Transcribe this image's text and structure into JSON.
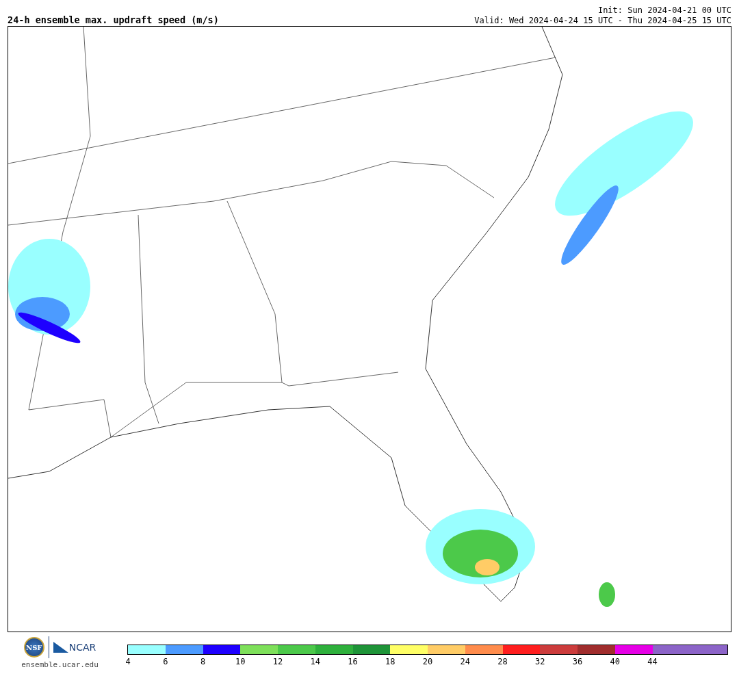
{
  "title": "24-h ensemble max. updraft speed (m/s)",
  "init": "Init: Sun 2024-04-21 00 UTC",
  "valid": "Valid: Wed 2024-04-24 15 UTC - Thu 2024-04-25 15 UTC",
  "logos": {
    "nsf": "NSF",
    "ncar": "NCAR",
    "url": "ensemble.ucar.edu"
  },
  "colorbar": [
    {
      "color": "#99ffff",
      "label": "4"
    },
    {
      "color": "#4c9bff",
      "label": "6"
    },
    {
      "color": "#1e00ff",
      "label": "8"
    },
    {
      "color": "#7ee05a",
      "label": "10"
    },
    {
      "color": "#4cc94a",
      "label": "12"
    },
    {
      "color": "#2eb03c",
      "label": "14"
    },
    {
      "color": "#1e9438",
      "label": "16"
    },
    {
      "color": "#ffff66",
      "label": "18"
    },
    {
      "color": "#ffcc66",
      "label": "20"
    },
    {
      "color": "#ff8c4c",
      "label": "24"
    },
    {
      "color": "#ff1e1e",
      "label": "28"
    },
    {
      "color": "#cc3c3c",
      "label": "32"
    },
    {
      "color": "#a02d2d",
      "label": "36"
    },
    {
      "color": "#e600e6",
      "label": "40"
    },
    {
      "color": "#8c64c8",
      "label": "44"
    },
    {
      "color": "#8c64c8"
    }
  ]
}
